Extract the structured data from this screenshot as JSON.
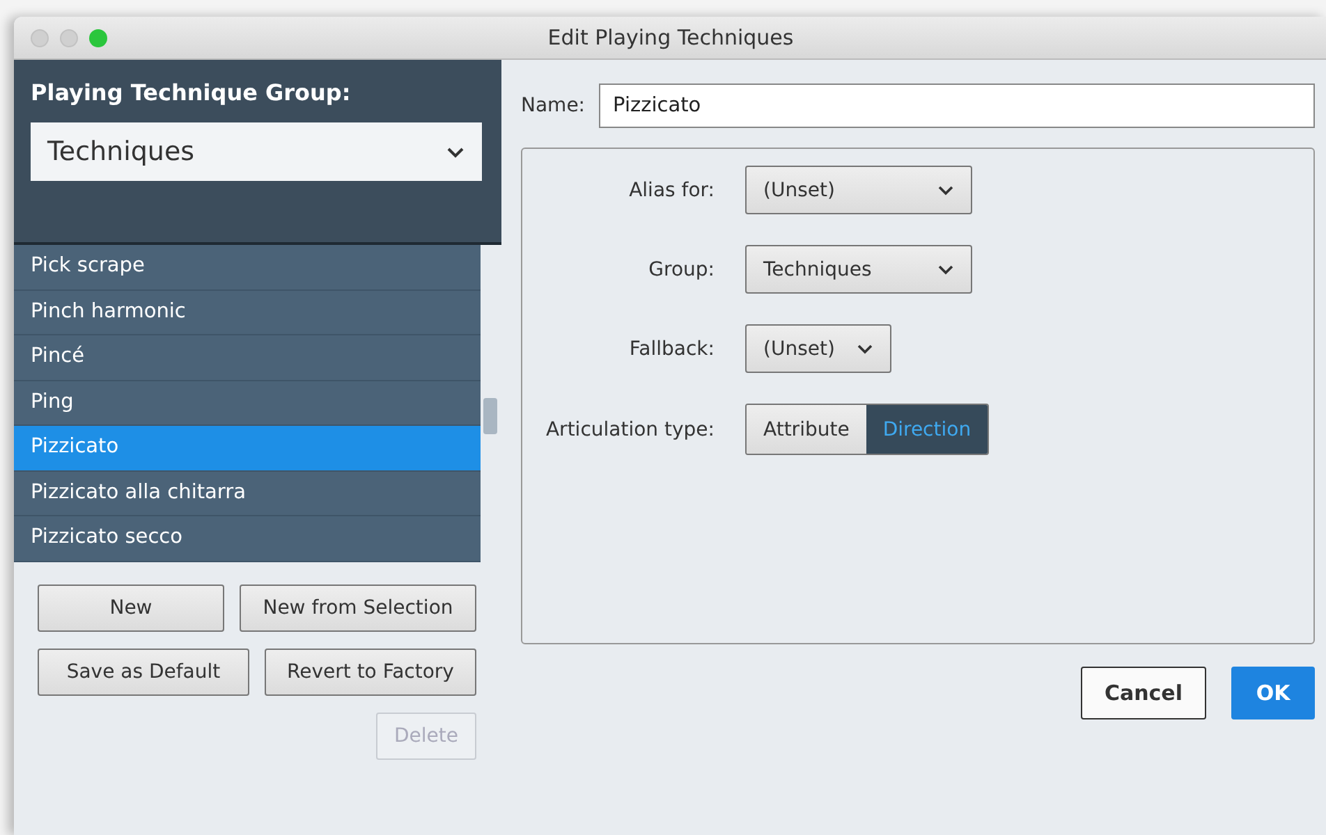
{
  "window": {
    "title": "Edit Playing Techniques"
  },
  "group_selector": {
    "label": "Playing Technique Group:",
    "value": "Techniques"
  },
  "techniques": [
    {
      "label": "Pick scrape",
      "selected": false
    },
    {
      "label": "Pinch harmonic",
      "selected": false
    },
    {
      "label": "Pincé",
      "selected": false
    },
    {
      "label": "Ping",
      "selected": false
    },
    {
      "label": "Pizzicato",
      "selected": true
    },
    {
      "label": "Pizzicato alla chitarra",
      "selected": false
    },
    {
      "label": "Pizzicato secco",
      "selected": false
    }
  ],
  "list_buttons": [
    [
      {
        "label": "New",
        "disabled": false
      },
      {
        "label": "New from Selection",
        "disabled": false
      }
    ],
    [
      {
        "label": "Save as Default",
        "disabled": false
      },
      {
        "label": "Revert to Factory",
        "disabled": false
      }
    ],
    [
      {
        "label": "Delete",
        "disabled": true
      }
    ]
  ],
  "name_field": {
    "label": "Name:",
    "value": "Pizzicato"
  },
  "properties": [
    {
      "kind": "dropdown",
      "label": "Alias for:",
      "value": "(Unset)"
    },
    {
      "kind": "dropdown",
      "label": "Group:",
      "value": "Techniques"
    },
    {
      "kind": "compact_dropdown",
      "label": "Fallback:",
      "value": "(Unset)"
    },
    {
      "kind": "segmented",
      "label": "Articulation type:",
      "options": [
        {
          "label": "Attribute",
          "selected": false
        },
        {
          "label": "Direction",
          "selected": true
        }
      ]
    }
  ],
  "dialog_buttons": [
    {
      "label": "Cancel",
      "primary": false
    },
    {
      "label": "OK",
      "primary": true
    }
  ]
}
